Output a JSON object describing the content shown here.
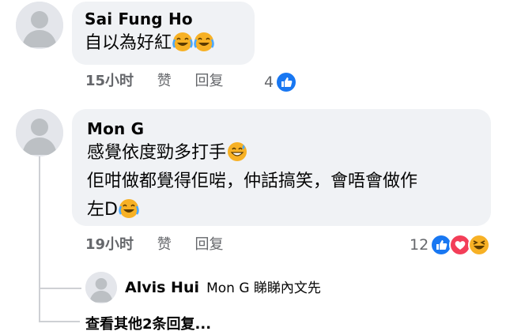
{
  "comments": [
    {
      "author": "Sai Fung Ho",
      "lines": [
        "自以為好紅"
      ],
      "emoji_suffix": [
        "laugh-cry-emoji",
        "laugh-cry-emoji"
      ],
      "time": "15小时",
      "like_label": "赞",
      "reply_label": "回复",
      "reaction_count": "4",
      "reactions": [
        "like"
      ]
    },
    {
      "author": "Mon G",
      "lines": [
        "感覺依度勁多打手",
        "佢咁做都覺得佢啱，仲話搞笑，會唔會做作",
        "左D"
      ],
      "time": "19小时",
      "like_label": "赞",
      "reply_label": "回复",
      "reaction_count": "12",
      "reactions": [
        "like",
        "love",
        "haha"
      ]
    }
  ],
  "reply_preview": {
    "author": "Alvis Hui",
    "text": "Mon G 睇睇內文先"
  },
  "more_replies": "查看其他2条回复...",
  "colors": {
    "bubble": "#f0f2f5",
    "like": "#1877f2",
    "love": "#f33e58",
    "haha": "#f7b125",
    "meta": "#65676b"
  }
}
